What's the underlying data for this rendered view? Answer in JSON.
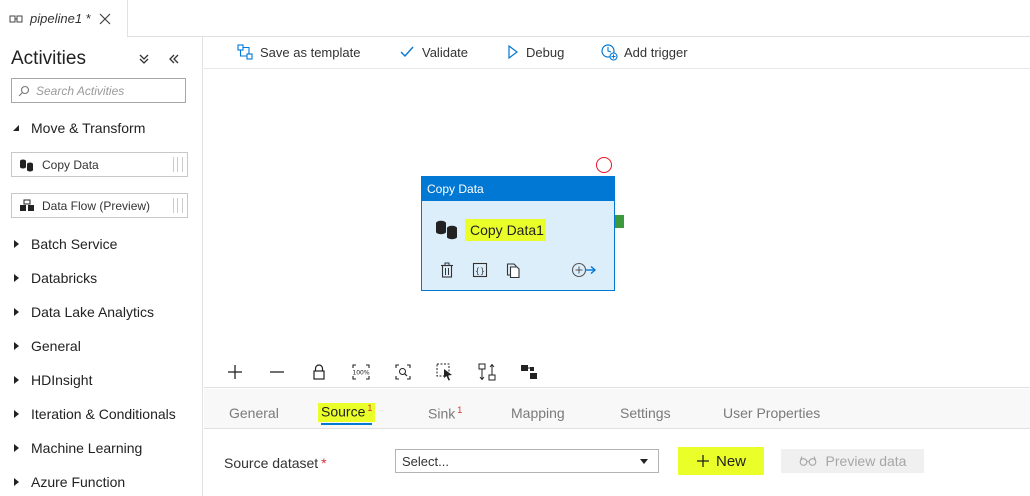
{
  "tab": {
    "title": "pipeline1",
    "dirty_marker": "*"
  },
  "activities": {
    "title": "Activities",
    "search_placeholder": "Search Activities",
    "expanded_category": "Move & Transform",
    "items": [
      {
        "label": "Copy Data"
      },
      {
        "label": "Data Flow (Preview)"
      }
    ],
    "categories": [
      {
        "label": "Batch Service"
      },
      {
        "label": "Databricks"
      },
      {
        "label": "Data Lake Analytics"
      },
      {
        "label": "General"
      },
      {
        "label": "HDInsight"
      },
      {
        "label": "Iteration & Conditionals"
      },
      {
        "label": "Machine Learning"
      },
      {
        "label": "Azure Function"
      }
    ]
  },
  "toolbar": {
    "save_as_template": "Save as template",
    "validate": "Validate",
    "debug": "Debug",
    "add_trigger": "Add trigger"
  },
  "node": {
    "type_label": "Copy Data",
    "name": "Copy Data1"
  },
  "canvas_tools": {
    "zoom_100_label": "100%"
  },
  "properties": {
    "tabs": [
      {
        "label": "General",
        "badge": ""
      },
      {
        "label": "Source",
        "badge": "1"
      },
      {
        "label": "Sink",
        "badge": "1"
      },
      {
        "label": "Mapping",
        "badge": ""
      },
      {
        "label": "Settings",
        "badge": ""
      },
      {
        "label": "User Properties",
        "badge": ""
      }
    ],
    "source_dataset_label": "Source dataset",
    "required_marker": "*",
    "select_value": "Select...",
    "new_button": "New",
    "preview_button": "Preview data"
  },
  "colors": {
    "accent": "#0078d4",
    "highlight": "#eaff2a",
    "error": "#e81123",
    "port": "#3c9a3c"
  }
}
